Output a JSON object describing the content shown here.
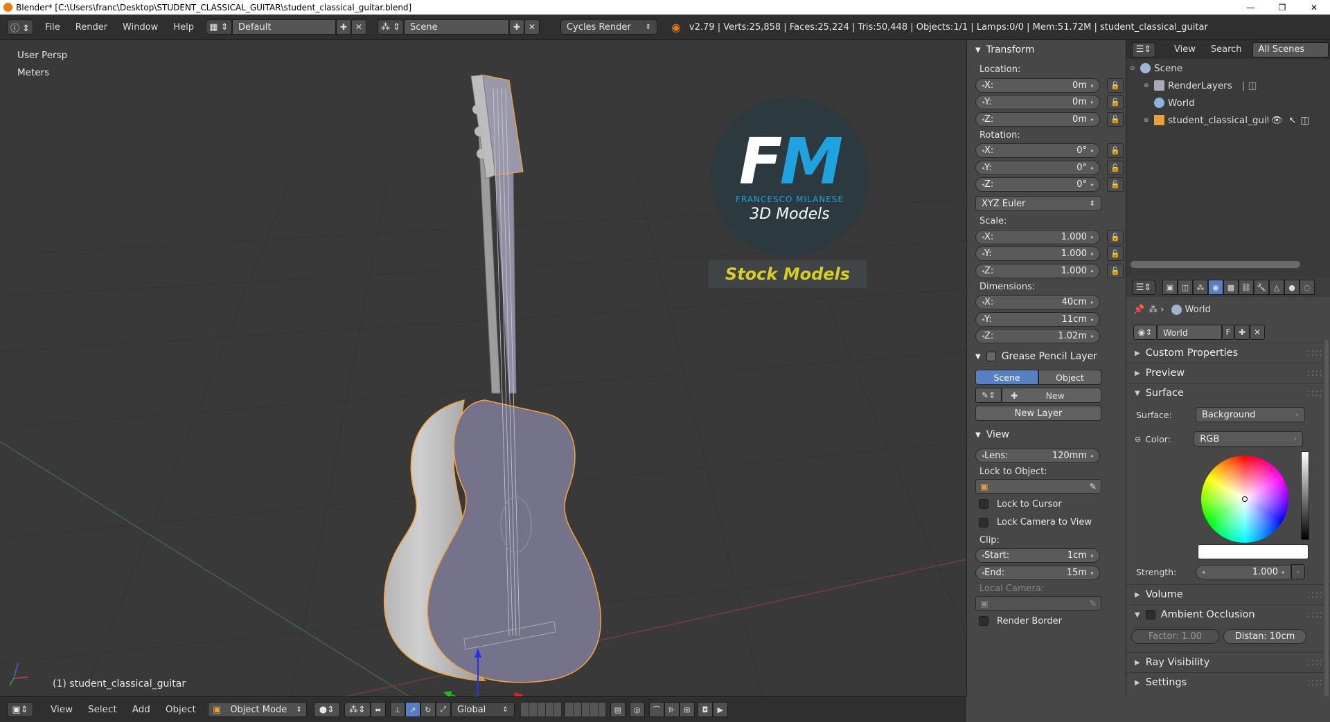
{
  "window": {
    "title": "Blender* [C:\\Users\\franc\\Desktop\\STUDENT_CLASSICAL_GUITAR\\student_classical_guitar.blend]",
    "minimize": "—",
    "maximize": "❐",
    "close": "✕"
  },
  "info_header": {
    "menus": [
      "File",
      "Render",
      "Window",
      "Help"
    ],
    "layout_name": "Default",
    "scene_name": "Scene",
    "render_engine": "Cycles Render",
    "stats": "v2.79 | Verts:25,858 | Faces:25,224 | Tris:50,448 | Objects:1/1 | Lamps:0/0 | Mem:51.72M | student_classical_guitar"
  },
  "viewport": {
    "view_name": "User Persp",
    "units": "Meters",
    "active_object": "(1) student_classical_guitar",
    "logo": {
      "letters": "FM",
      "author": "FRANCESCO MILANESE",
      "subtitle": "3D Models",
      "banner": "Stock Models"
    }
  },
  "npanel": {
    "transform_title": "Transform",
    "location_label": "Location:",
    "location": [
      {
        "axis": "X:",
        "value": "0m"
      },
      {
        "axis": "Y:",
        "value": "0m"
      },
      {
        "axis": "Z:",
        "value": "0m"
      }
    ],
    "rotation_label": "Rotation:",
    "rotation": [
      {
        "axis": "X:",
        "value": "0°"
      },
      {
        "axis": "Y:",
        "value": "0°"
      },
      {
        "axis": "Z:",
        "value": "0°"
      }
    ],
    "rotation_mode": "XYZ Euler",
    "scale_label": "Scale:",
    "scale": [
      {
        "axis": "X:",
        "value": "1.000"
      },
      {
        "axis": "Y:",
        "value": "1.000"
      },
      {
        "axis": "Z:",
        "value": "1.000"
      }
    ],
    "dimensions_label": "Dimensions:",
    "dimensions": [
      {
        "axis": "X:",
        "value": "40cm"
      },
      {
        "axis": "Y:",
        "value": "11cm"
      },
      {
        "axis": "Z:",
        "value": "1.02m"
      }
    ],
    "grease_pencil_title": "Grease Pencil Layer",
    "gp_scene": "Scene",
    "gp_object": "Object",
    "gp_new": "New",
    "gp_new_layer": "New Layer",
    "view_title": "View",
    "lens_label": "Lens:",
    "lens_value": "120mm",
    "lock_to_object": "Lock to Object:",
    "lock_to_cursor": "Lock to Cursor",
    "lock_camera": "Lock Camera to View",
    "clip_label": "Clip:",
    "clip_start_label": "Start:",
    "clip_start": "1cm",
    "clip_end_label": "End:",
    "clip_end": "15m",
    "local_camera": "Local Camera:",
    "render_border": "Render Border"
  },
  "outliner": {
    "view": "View",
    "search": "Search",
    "filter": "All Scenes",
    "items": [
      "Scene",
      "RenderLayers",
      "World",
      "student_classical_guita"
    ]
  },
  "properties": {
    "context_name": "World",
    "world_field": "World",
    "fake_user": "F",
    "sections": {
      "custom_properties": "Custom Properties",
      "preview": "Preview",
      "surface": "Surface",
      "volume": "Volume",
      "ambient_occlusion": "Ambient Occlusion",
      "ray_visibility": "Ray Visibility",
      "settings": "Settings"
    },
    "surface_label": "Surface:",
    "surface_value": "Background",
    "color_label": "Color:",
    "color_mode": "RGB",
    "strength_label": "Strength:",
    "strength_value": "1.000",
    "ao_factor": "Factor:  1.00",
    "ao_distance": "Distan: 10cm"
  },
  "footer": {
    "menus": [
      "View",
      "Select",
      "Add",
      "Object"
    ],
    "mode": "Object Mode",
    "orientation": "Global"
  },
  "colors": {
    "accent": "#5680c2",
    "selection": "#f5a433",
    "viewport_bg": "#393939"
  }
}
